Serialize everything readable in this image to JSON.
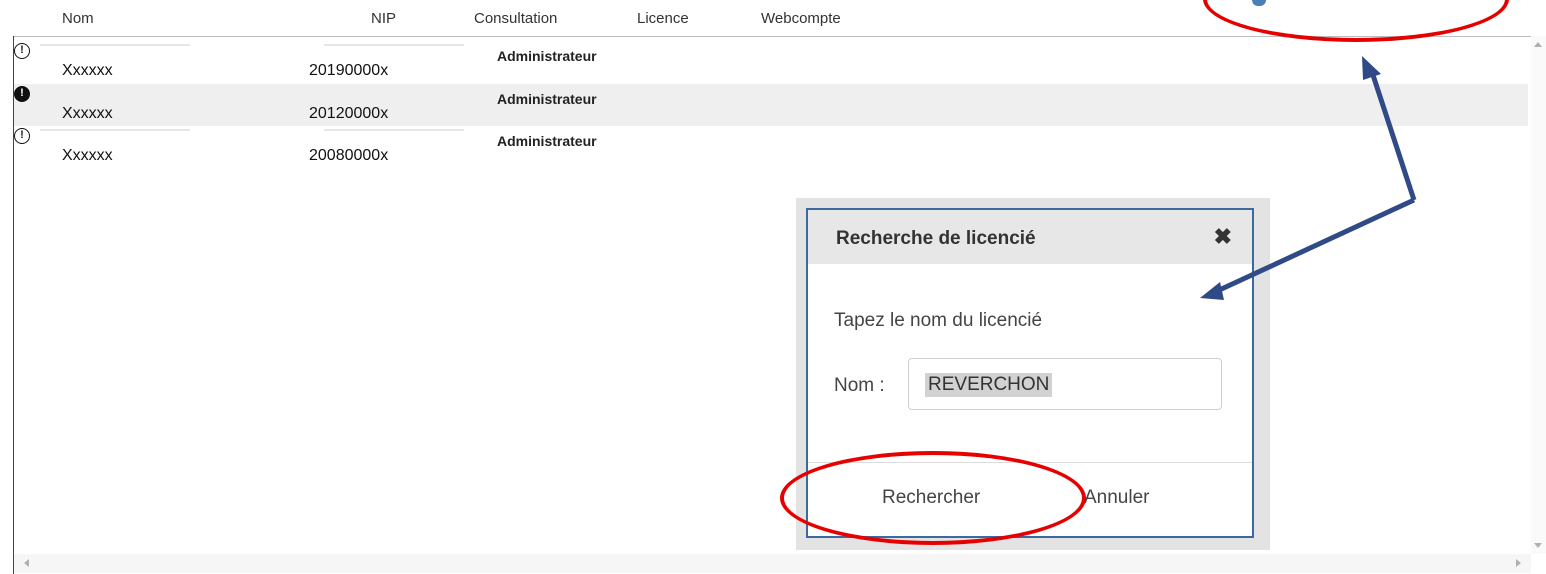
{
  "columns": {
    "nom": "Nom",
    "nip": "NIP",
    "consultation": "Consultation",
    "licence": "Licence",
    "webcompte": "Webcompte"
  },
  "rows": [
    {
      "nom": "Xxxxxx",
      "nip": "20190000x",
      "consultation": "Administrateur"
    },
    {
      "nom": "Xxxxxx",
      "nip": "20120000x",
      "consultation": "Administrateur"
    },
    {
      "nom": "Xxxxxx",
      "nip": "20080000x",
      "consultation": "Administrateur"
    }
  ],
  "dialog": {
    "title": "Recherche de licencié",
    "close_glyph": "✖",
    "prompt": "Tapez le nom du licencié",
    "nom_label": "Nom :",
    "nom_value": "REVERCHON",
    "search_button": "Rechercher",
    "cancel_button": "Annuler"
  },
  "icons": {
    "user": "user-icon",
    "close": "close-icon"
  },
  "colors": {
    "annotation_red": "#e60000",
    "arrow_blue": "#2f4a86",
    "dialog_border": "#3a6aa0",
    "row_alt": "#efefef"
  }
}
